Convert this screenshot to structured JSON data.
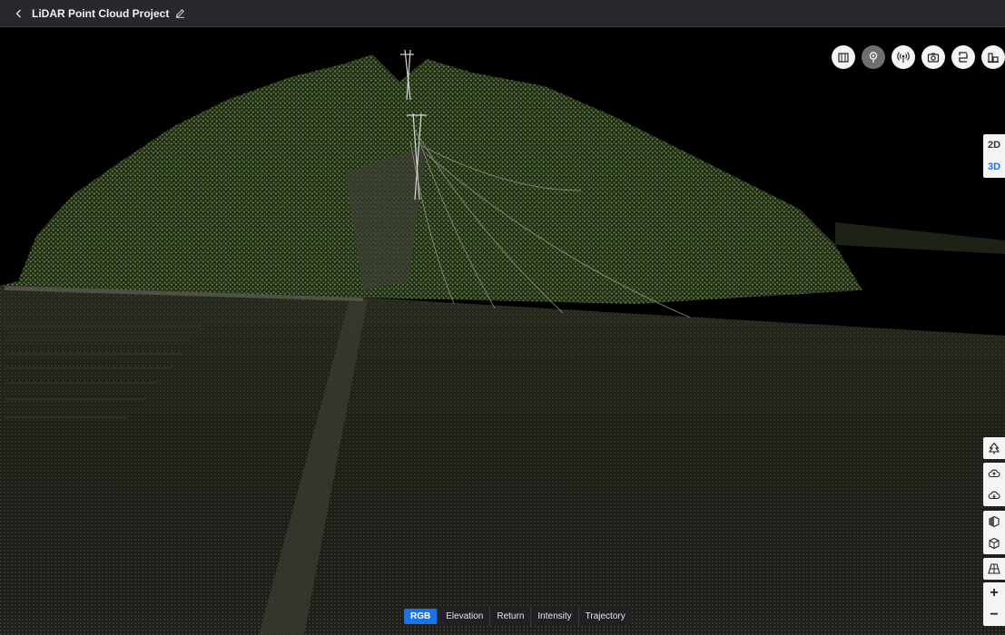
{
  "header": {
    "title": "LiDAR Point Cloud Project"
  },
  "toolbar_top": {
    "icons": [
      "map-icon",
      "location-pin-icon",
      "signal-icon",
      "camera-icon",
      "route-icon",
      "building-chart-icon"
    ],
    "active": "location-pin-icon"
  },
  "view_toggle": {
    "options": [
      "2D",
      "3D"
    ],
    "selected": "3D"
  },
  "side_tools": {
    "icons": [
      "tree-icon",
      "cloud-up-icon",
      "cloud-down-icon",
      "box-half-icon",
      "box-icon",
      "grid-perspective-icon"
    ],
    "zoom_in": "+",
    "zoom_out": "−"
  },
  "color_modes": {
    "tabs": [
      "RGB",
      "Elevation",
      "Return",
      "Intensity",
      "Trajectory"
    ],
    "selected": "RGB"
  },
  "colors": {
    "accent": "#1a74e8",
    "header_bg": "#26282c"
  }
}
